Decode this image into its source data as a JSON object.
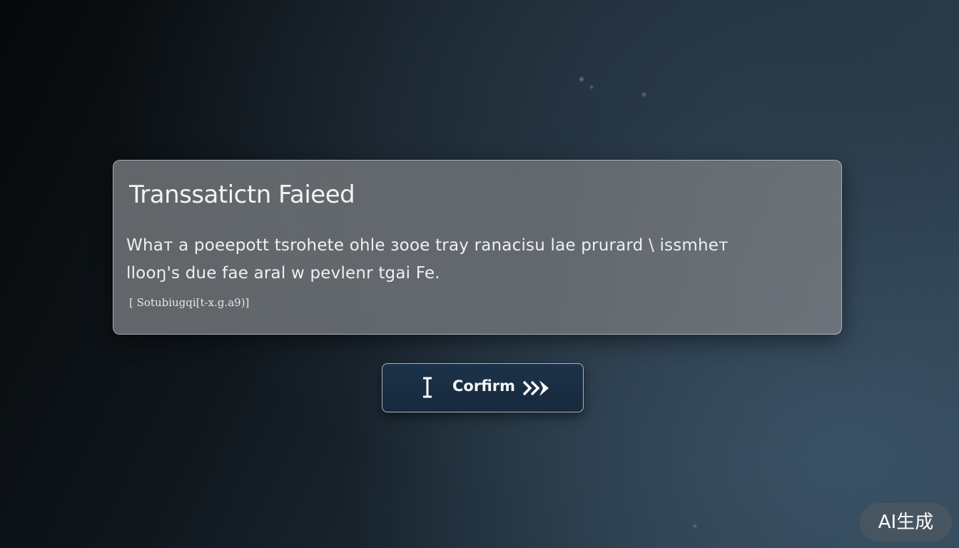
{
  "dialog": {
    "title": "Transsatictn Faieed",
    "message_line_1": "Whaт a poeepott tsrohete  ohle зooe tray ranacisu lae  prurard \\ issmhет",
    "message_line_2": "llooŋ's  due  fae  aral  w  pevlenr tgai Fe.",
    "code": "[ Sotubiugqi[t-x.g.a9)]"
  },
  "confirm_button": {
    "label": "Corfirm",
    "left_icon": "vertical-double-arrow-icon",
    "right_icon": "double-chevron-right-icon"
  },
  "badge": {
    "text": "AI生成"
  },
  "colors": {
    "dialog_background": "#767a7e",
    "button_background": "#1b3147",
    "text": "#f1f3f5"
  }
}
